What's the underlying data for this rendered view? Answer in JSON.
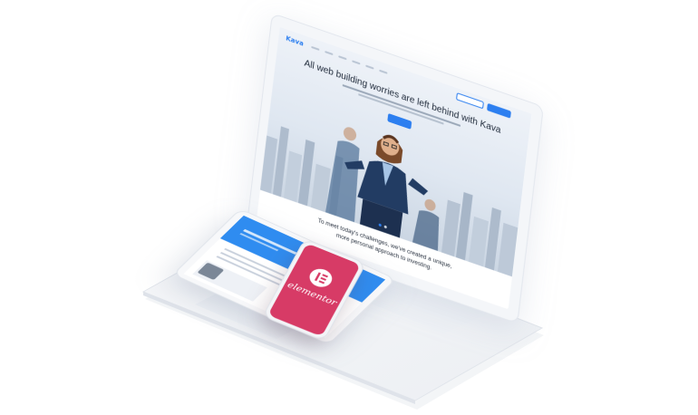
{
  "laptop": {
    "site": {
      "logo": "Kava",
      "headline": "All web building worries are left behind with Kava",
      "tagline_lines": [
        "To meet today's challenges, we've created a unique,",
        "more personal approach to investing."
      ]
    }
  },
  "tablet": {},
  "phone": {
    "brand": "elementor"
  },
  "colors": {
    "accent": "#2d7ff0",
    "elementor_pink": "#d73b66"
  }
}
